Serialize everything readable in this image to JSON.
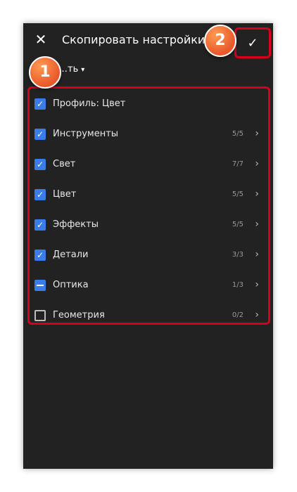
{
  "header": {
    "title": "Скопировать настройки",
    "close_icon": "close-icon",
    "confirm_icon": "check-icon"
  },
  "dropdown": {
    "label": "…ть",
    "icon": "chevron-down-icon"
  },
  "annotations": [
    {
      "number": "1"
    },
    {
      "number": "2"
    }
  ],
  "items": [
    {
      "label": "Профиль: Цвет",
      "count": "",
      "state": "checked",
      "has_chevron": false
    },
    {
      "label": "Инструменты",
      "count": "5/5",
      "state": "checked",
      "has_chevron": true
    },
    {
      "label": "Свет",
      "count": "7/7",
      "state": "checked",
      "has_chevron": true
    },
    {
      "label": "Цвет",
      "count": "5/5",
      "state": "checked",
      "has_chevron": true
    },
    {
      "label": "Эффекты",
      "count": "5/5",
      "state": "checked",
      "has_chevron": true
    },
    {
      "label": "Детали",
      "count": "3/3",
      "state": "checked",
      "has_chevron": true
    },
    {
      "label": "Оптика",
      "count": "1/3",
      "state": "partial",
      "has_chevron": true
    },
    {
      "label": "Геометрия",
      "count": "0/2",
      "state": "unchecked",
      "has_chevron": true
    }
  ],
  "colors": {
    "background": "#222222",
    "accent": "#3b7de8",
    "highlight": "#d8001b",
    "badge": "#e8582a"
  }
}
